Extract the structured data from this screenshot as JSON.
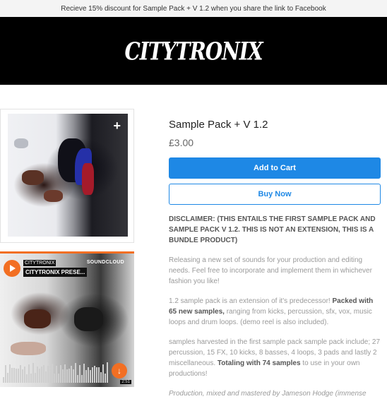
{
  "announcement": "Recieve 15% discount for Sample Pack + V 1.2 when you share the link to Facebook",
  "brand": "CITYTRONIX",
  "colors": {
    "accent": "#1e88e5",
    "soundcloud": "#f26f23",
    "header_bg": "#000000"
  },
  "gallery": {
    "expand_icon": "plus-icon"
  },
  "soundcloud": {
    "artist": "CITYTRONIX",
    "track_title": "CITYTRONIX PRESE...",
    "logo_text": "SOUNDCLOUD",
    "duration": "2:51"
  },
  "product": {
    "title": "Sample Pack + V 1.2",
    "price": "£3.00",
    "add_to_cart": "Add to Cart",
    "buy_now": "Buy Now",
    "disclaimer": "DISCLAIMER: (THIS ENTAILS THE FIRST SAMPLE PACK AND SAMPLE PACK V 1.2. THIS IS NOT AN EXTENSION, THIS IS A BUNDLE PRODUCT)",
    "intro": "Releasing a new set of sounds for your production and editing needs. Feel free to incorporate and implement them in whichever fashion you like!",
    "p2_lead": "1.2 sample pack is an extension of it's predecessor! ",
    "p2_bold": "Packed with 65 new samples,",
    "p2_rest": " ranging from kicks, percussion, sfx, vox, music loops and drum loops. (demo reel is also included).",
    "p3_lead": "samples harvested in the first sample pack sample pack include; 27 percussion, 15 FX, 10 kicks, 8 basses, 4 loops, 3 pads and lastly 2 miscellaneous. ",
    "p3_bold": "Totaling with 74 samples",
    "p3_rest": " to use in your own productions!",
    "credits": "Production, mixed and mastered by Jameson Hodge (immense"
  }
}
